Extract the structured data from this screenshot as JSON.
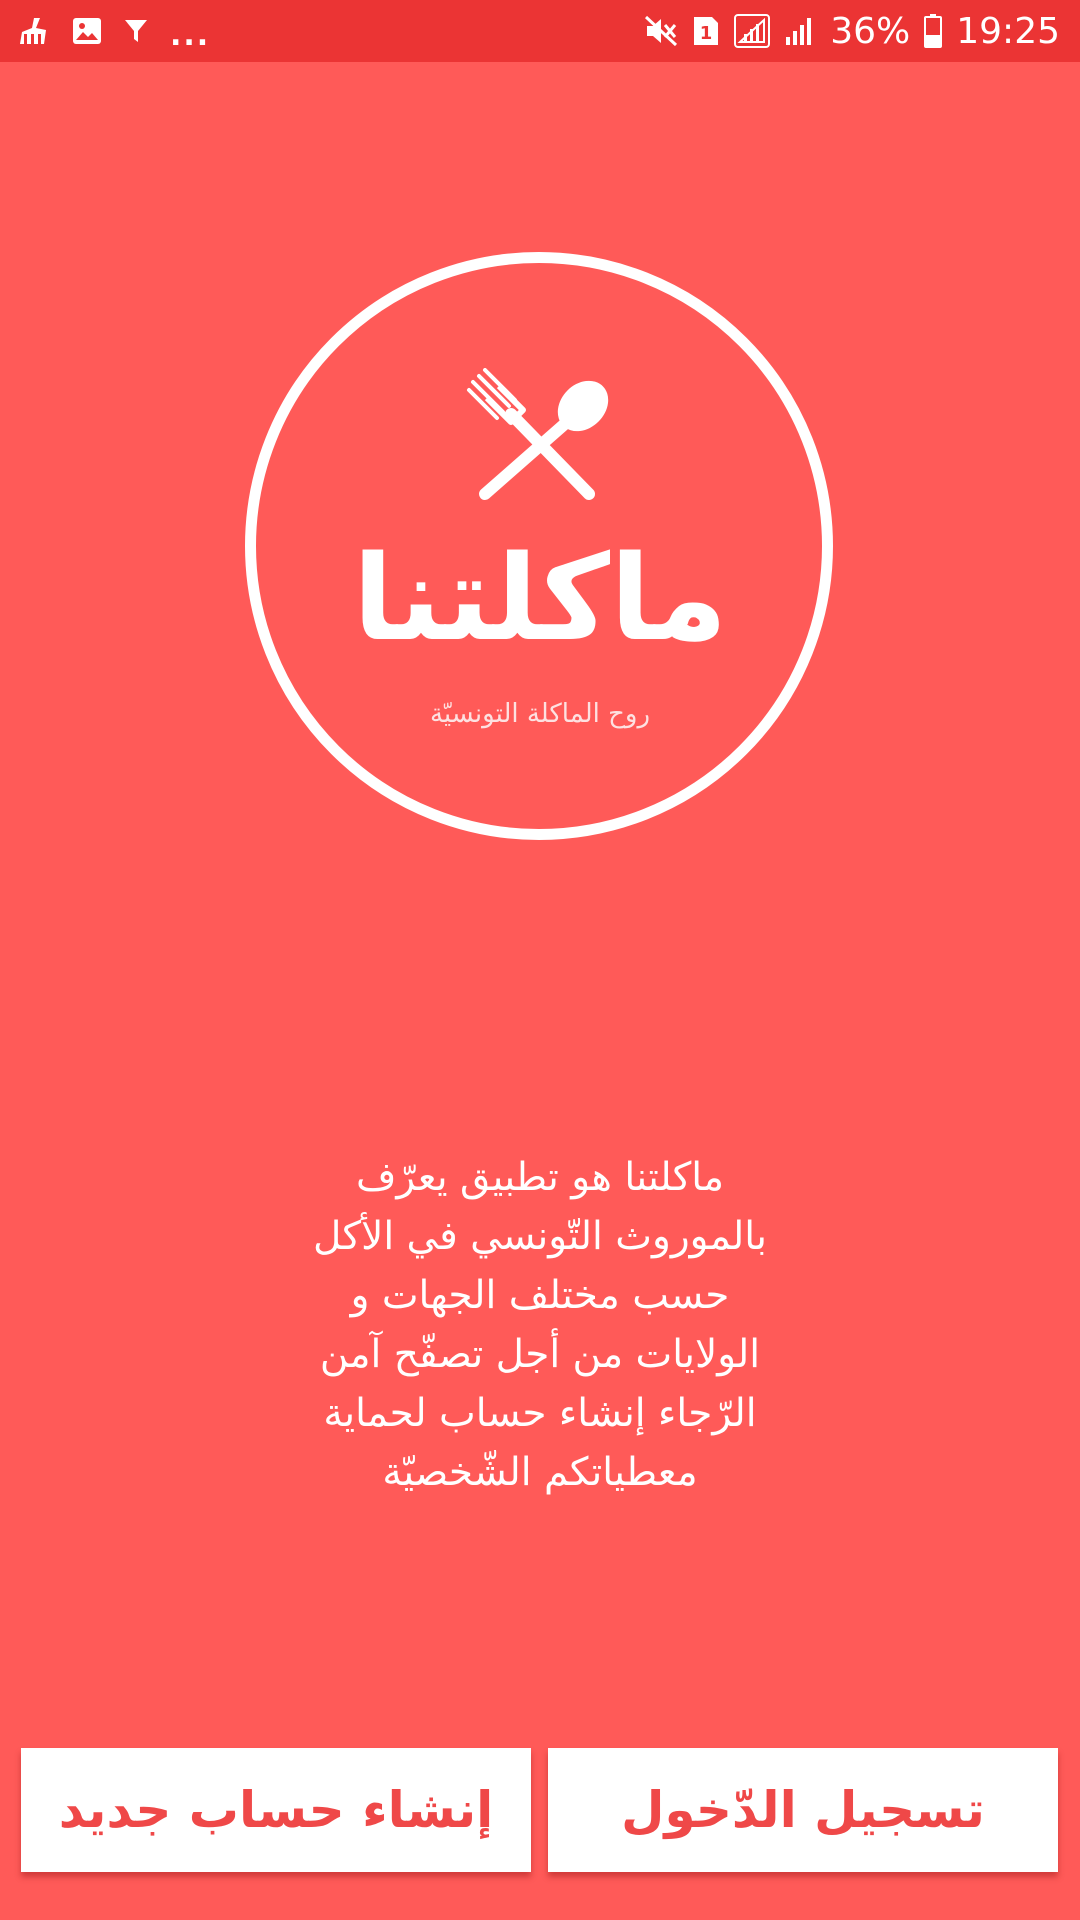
{
  "status_bar": {
    "left_icons": [
      "cleaner-icon",
      "image-icon",
      "funnel-icon"
    ],
    "more": "...",
    "right_icons": [
      "mute-icon",
      "sim1-icon",
      "signal-icon",
      "signal-icon"
    ],
    "battery": "36%",
    "time": "19:25"
  },
  "logo": {
    "icon": "fork-spoon-icon",
    "name": "ماكلتنا",
    "tagline": "روح الماكلة التونسيّة"
  },
  "description": {
    "lines": [
      "ماكلتنا هو تطبيق يعرّف",
      "بالموروث التّونسي في الأكل",
      "حسب مختلف الجهات و",
      "الولايات من أجل تصفّح آمن",
      "الرّجاء إنشاء حساب لحماية",
      "معطياتكم الشّخصيّة"
    ]
  },
  "buttons": {
    "register_label": "إنشاء حساب جديد",
    "login_label": "تسجيل الدّخول"
  },
  "colors": {
    "background": "#FF5A58",
    "status_bar": "#EB3434",
    "button_text": "#EF4848",
    "button_bg": "#FFFFFF"
  }
}
